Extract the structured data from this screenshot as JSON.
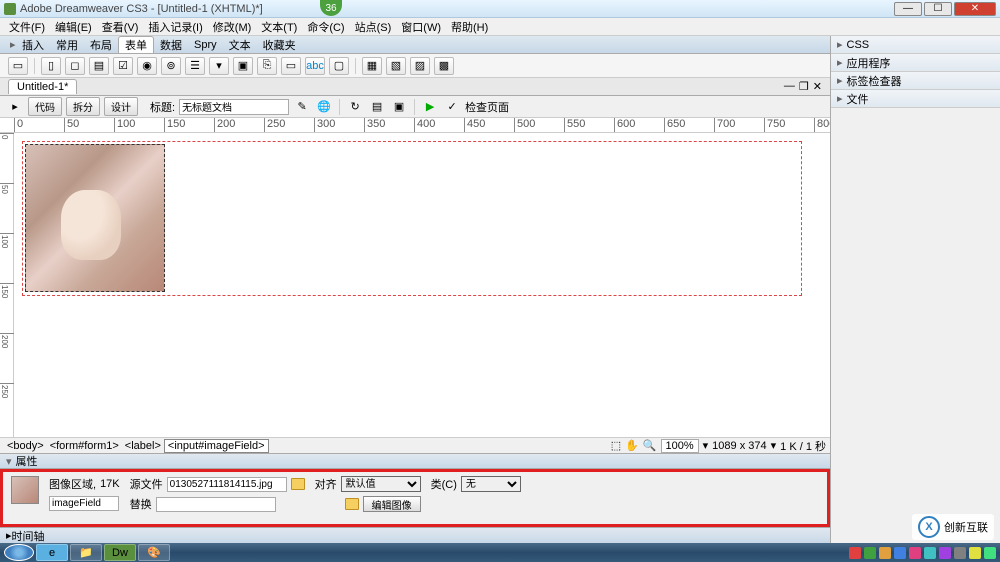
{
  "window": {
    "title": "Adobe Dreamweaver CS3 - [Untitled-1 (XHTML)*]",
    "badge": "36",
    "min": "—",
    "max": "☐",
    "close": "✕"
  },
  "menu": [
    "文件(F)",
    "编辑(E)",
    "查看(V)",
    "插入记录(I)",
    "修改(M)",
    "文本(T)",
    "命令(C)",
    "站点(S)",
    "窗口(W)",
    "帮助(H)"
  ],
  "insertbar": {
    "arrow": "▸",
    "label": "插入",
    "tabs": [
      "常用",
      "布局",
      "表单",
      "数据",
      "Spry",
      "文本",
      "收藏夹"
    ],
    "active": 2
  },
  "doc": {
    "tab": "Untitled-1*",
    "minimize": "—",
    "restore": "❐",
    "close": "✕"
  },
  "viewbar": {
    "code": "代码",
    "split": "拆分",
    "design": "设计",
    "title_label": "标题:",
    "title_value": "无标题文档",
    "check_label": "检查页面"
  },
  "ruler_marks": [
    "0",
    "50",
    "100",
    "150",
    "200",
    "250",
    "300",
    "350",
    "400",
    "450",
    "500",
    "550",
    "600",
    "650",
    "700",
    "750",
    "800"
  ],
  "vruler_marks": [
    "0",
    "50",
    "100",
    "150",
    "200",
    "250"
  ],
  "tagselector": {
    "tags": [
      "<body>",
      "<form#form1>",
      "<label>",
      "<input#imageField>"
    ],
    "zoom": "100%",
    "dims": "1089 x 374",
    "rate": "1 K / 1 秒"
  },
  "properties": {
    "header": "属性",
    "type_label": "图像区域,",
    "size": "17K",
    "name_value": "imageField",
    "src_label": "源文件",
    "src_value": "0130527111814115.jpg",
    "alt_label": "替换",
    "alt_value": "",
    "align_label": "对齐",
    "align_value": "默认值",
    "class_label": "类(C)",
    "class_value": "无",
    "edit_btn": "编辑图像"
  },
  "timeline": {
    "header": "时间轴"
  },
  "rightpanels": [
    "CSS",
    "应用程序",
    "标签检查器",
    "文件"
  ],
  "watermark": {
    "logo": "X",
    "text": "创新互联"
  },
  "tray_colors": [
    "#e04040",
    "#40a040",
    "#e0a040",
    "#4080e0",
    "#e04080",
    "#40c0c0",
    "#a040e0",
    "#808080",
    "#e0e040",
    "#40e080"
  ]
}
